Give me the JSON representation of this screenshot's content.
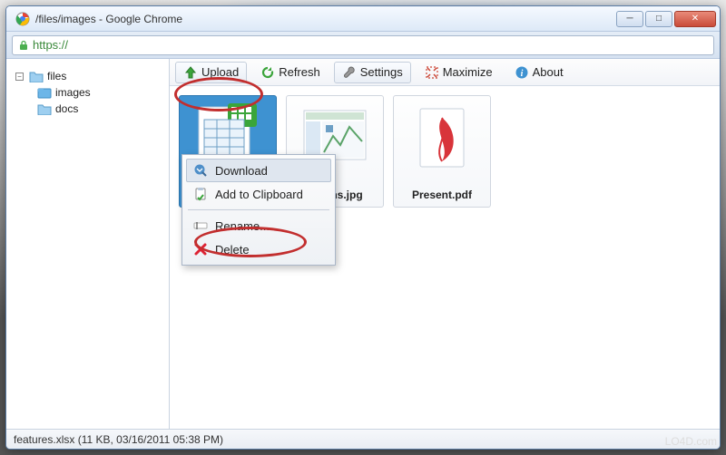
{
  "window": {
    "title": "/files/images - Google Chrome"
  },
  "address": {
    "scheme": "https://"
  },
  "tree": {
    "root": {
      "label": "files"
    },
    "children": [
      {
        "label": "images",
        "selected": true
      },
      {
        "label": "docs",
        "selected": false
      }
    ]
  },
  "toolbar": {
    "upload": "Upload",
    "refresh": "Refresh",
    "settings": "Settings",
    "maximize": "Maximize",
    "about": "About"
  },
  "files": [
    {
      "name": "features.xlsx",
      "type": "xlsx",
      "selected": true
    },
    {
      "name": "graphs.jpg",
      "type": "jpg",
      "selected": false
    },
    {
      "name": "Present.pdf",
      "type": "pdf",
      "selected": false
    }
  ],
  "context_menu": {
    "download": "Download",
    "clipboard": "Add to Clipboard",
    "rename": "Rename...",
    "delete": "Delete"
  },
  "status": "features.xlsx (11 KB, 03/16/2011 05:38 PM)",
  "watermark": "LO4D.com"
}
